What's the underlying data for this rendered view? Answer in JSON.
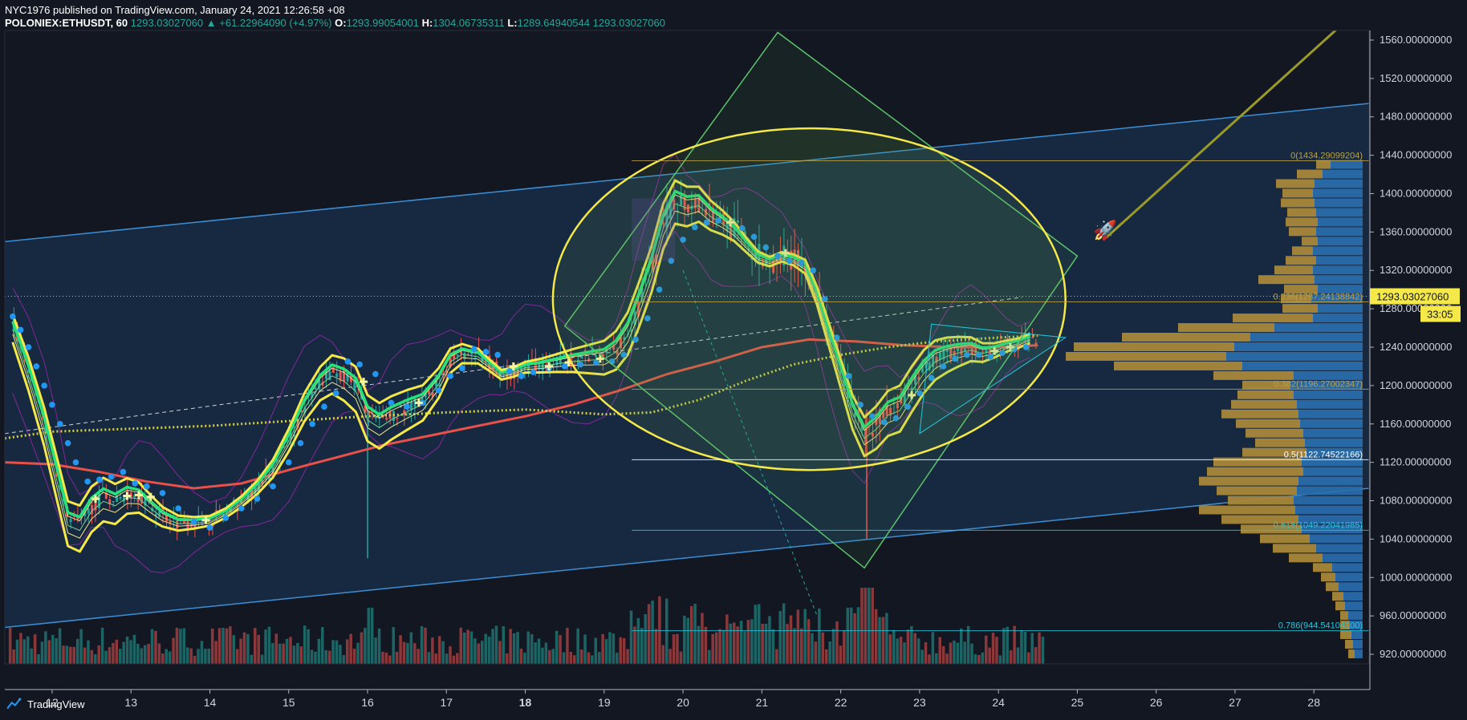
{
  "header": {
    "publisher_line": "NYC1976 published on TradingView.com, January 24, 2021 12:26:58 +08",
    "symbol": "POLONIEX:ETHUSDT, 60",
    "last": "1293.03027060",
    "change": "+61.22964090 (+4.97%)",
    "o_label": "O:",
    "o_value": "1293.99054001",
    "h_label": "H:",
    "h_value": "1304.06735311",
    "l_label": "L:",
    "l_value": "1289.64940544",
    "c_value": "1293.03027060"
  },
  "footer": {
    "brand": "TradingView"
  },
  "colors": {
    "background": "#131722",
    "axis_text": "#d1d4dc",
    "up_volume": "#26a69a",
    "down_volume": "#ef5350",
    "ema_yellow": "#f5e94a",
    "ema_green": "#27e27a",
    "sar_blue": "#2196f3",
    "ma_red": "#e8514a",
    "channel": "#3b8fd6",
    "fib_gold": "#b8a04a",
    "profile_blue": "#2a6fb0",
    "profile_gold": "#a8873a",
    "price_tag": "#f5e94a"
  },
  "chart_data": {
    "type": "candlestick",
    "y_ticks": [
      "1560.00000000",
      "1520.00000000",
      "1480.00000000",
      "1440.00000000",
      "1400.00000000",
      "1360.00000000",
      "1320.00000000",
      "1280.00000000",
      "1240.00000000",
      "1200.00000000",
      "1160.00000000",
      "1120.00000000",
      "1080.00000000",
      "1040.00000000",
      "1000.00000000",
      "960.00000000",
      "920.00000000"
    ],
    "ylim": [
      910,
      1570
    ],
    "x_ticks": [
      "12",
      "13",
      "14",
      "15",
      "16",
      "17",
      "18",
      "19",
      "20",
      "21",
      "22",
      "23",
      "24",
      "25",
      "26",
      "27",
      "28"
    ],
    "x_bold": [
      "18"
    ],
    "xlim": [
      11.4,
      28.7
    ],
    "last_price_label": "1293.03027060",
    "countdown": "33:05",
    "last_price": 1293.03,
    "fib_levels": [
      {
        "label": "0(1434.29099204)",
        "value": 1434.29
      },
      {
        "label": "0.236(1287.24138842)",
        "value": 1287.24
      },
      {
        "label": "0.382(1196.27002347)",
        "value": 1196.27
      },
      {
        "label": "0.5(1122.74522166)",
        "value": 1122.75
      },
      {
        "label": "0.618(1049.22041985)",
        "value": 1049.22
      },
      {
        "label": "0.786(944.54104100)",
        "value": 944.54
      }
    ],
    "fib_x_start": 19.35,
    "price_path": [
      [
        11.5,
        1262
      ],
      [
        11.7,
        1215
      ],
      [
        11.9,
        1160
      ],
      [
        12.05,
        1110
      ],
      [
        12.2,
        1060
      ],
      [
        12.35,
        1055
      ],
      [
        12.5,
        1075
      ],
      [
        12.65,
        1085
      ],
      [
        12.8,
        1080
      ],
      [
        12.95,
        1088
      ],
      [
        13.1,
        1086
      ],
      [
        13.25,
        1075
      ],
      [
        13.4,
        1065
      ],
      [
        13.6,
        1058
      ],
      [
        13.8,
        1058
      ],
      [
        14.0,
        1060
      ],
      [
        14.2,
        1068
      ],
      [
        14.4,
        1080
      ],
      [
        14.6,
        1095
      ],
      [
        14.8,
        1115
      ],
      [
        15.0,
        1145
      ],
      [
        15.2,
        1180
      ],
      [
        15.4,
        1205
      ],
      [
        15.55,
        1215
      ],
      [
        15.7,
        1210
      ],
      [
        15.85,
        1200
      ],
      [
        16.0,
        1170
      ],
      [
        16.15,
        1162
      ],
      [
        16.3,
        1170
      ],
      [
        16.5,
        1178
      ],
      [
        16.7,
        1185
      ],
      [
        16.9,
        1205
      ],
      [
        17.05,
        1228
      ],
      [
        17.2,
        1235
      ],
      [
        17.4,
        1232
      ],
      [
        17.55,
        1222
      ],
      [
        17.7,
        1212
      ],
      [
        17.85,
        1215
      ],
      [
        18.0,
        1220
      ],
      [
        18.2,
        1222
      ],
      [
        18.4,
        1225
      ],
      [
        18.6,
        1228
      ],
      [
        18.8,
        1230
      ],
      [
        19.0,
        1232
      ],
      [
        19.15,
        1240
      ],
      [
        19.3,
        1258
      ],
      [
        19.45,
        1290
      ],
      [
        19.6,
        1325
      ],
      [
        19.75,
        1370
      ],
      [
        19.9,
        1395
      ],
      [
        20.05,
        1390
      ],
      [
        20.2,
        1392
      ],
      [
        20.35,
        1380
      ],
      [
        20.5,
        1372
      ],
      [
        20.65,
        1362
      ],
      [
        20.8,
        1348
      ],
      [
        20.95,
        1335
      ],
      [
        21.1,
        1330
      ],
      [
        21.25,
        1335
      ],
      [
        21.4,
        1332
      ],
      [
        21.55,
        1325
      ],
      [
        21.7,
        1295
      ],
      [
        21.85,
        1255
      ],
      [
        22.0,
        1215
      ],
      [
        22.15,
        1175
      ],
      [
        22.3,
        1150
      ],
      [
        22.45,
        1160
      ],
      [
        22.6,
        1175
      ],
      [
        22.75,
        1180
      ],
      [
        22.9,
        1200
      ],
      [
        23.05,
        1218
      ],
      [
        23.2,
        1230
      ],
      [
        23.35,
        1235
      ],
      [
        23.5,
        1238
      ],
      [
        23.65,
        1240
      ],
      [
        23.8,
        1236
      ],
      [
        23.95,
        1238
      ],
      [
        24.1,
        1242
      ],
      [
        24.25,
        1245
      ],
      [
        24.4,
        1250
      ]
    ],
    "ma_red": [
      [
        11.4,
        1120
      ],
      [
        12,
        1118
      ],
      [
        12.6,
        1110
      ],
      [
        13.2,
        1100
      ],
      [
        13.8,
        1093
      ],
      [
        14.4,
        1098
      ],
      [
        15,
        1112
      ],
      [
        15.6,
        1125
      ],
      [
        16.2,
        1138
      ],
      [
        16.8,
        1148
      ],
      [
        17.4,
        1158
      ],
      [
        18,
        1168
      ],
      [
        18.6,
        1180
      ],
      [
        19.2,
        1195
      ],
      [
        19.8,
        1212
      ],
      [
        20.4,
        1225
      ],
      [
        21,
        1240
      ],
      [
        21.6,
        1248
      ],
      [
        22.2,
        1246
      ],
      [
        22.8,
        1242
      ],
      [
        23.4,
        1240
      ],
      [
        24,
        1240
      ],
      [
        24.5,
        1242
      ]
    ],
    "ma_dotted": [
      [
        11.4,
        1145
      ],
      [
        12,
        1152
      ],
      [
        13,
        1155
      ],
      [
        14,
        1158
      ],
      [
        15,
        1163
      ],
      [
        16,
        1168
      ],
      [
        17,
        1172
      ],
      [
        18,
        1175
      ],
      [
        19,
        1170
      ],
      [
        19.6,
        1172
      ],
      [
        20.2,
        1185
      ],
      [
        20.8,
        1205
      ],
      [
        21.4,
        1222
      ],
      [
        22,
        1232
      ],
      [
        22.6,
        1240
      ],
      [
        23.2,
        1246
      ],
      [
        24,
        1250
      ],
      [
        24.5,
        1252
      ]
    ],
    "sar_points": [
      [
        11.5,
        1272
      ],
      [
        11.6,
        1258
      ],
      [
        11.7,
        1240
      ],
      [
        11.8,
        1220
      ],
      [
        11.9,
        1200
      ],
      [
        12.0,
        1180
      ],
      [
        12.1,
        1160
      ],
      [
        12.2,
        1140
      ],
      [
        12.3,
        1120
      ],
      [
        12.45,
        1100
      ],
      [
        12.6,
        1102
      ],
      [
        12.75,
        1105
      ],
      [
        12.9,
        1110
      ],
      [
        13.05,
        1098
      ],
      [
        13.2,
        1095
      ],
      [
        13.4,
        1088
      ],
      [
        13.6,
        1072
      ],
      [
        13.8,
        1058
      ],
      [
        14.0,
        1052
      ],
      [
        14.2,
        1062
      ],
      [
        14.4,
        1072
      ],
      [
        14.6,
        1082
      ],
      [
        14.8,
        1095
      ],
      [
        15.0,
        1120
      ],
      [
        15.15,
        1140
      ],
      [
        15.3,
        1160
      ],
      [
        15.45,
        1178
      ],
      [
        15.6,
        1192
      ],
      [
        15.75,
        1225
      ],
      [
        15.9,
        1222
      ],
      [
        16.1,
        1212
      ],
      [
        16.3,
        1182
      ],
      [
        16.5,
        1178
      ],
      [
        16.7,
        1182
      ],
      [
        16.9,
        1195
      ],
      [
        17.05,
        1210
      ],
      [
        17.2,
        1218
      ],
      [
        17.35,
        1238
      ],
      [
        17.5,
        1235
      ],
      [
        17.65,
        1232
      ],
      [
        17.8,
        1215
      ],
      [
        17.95,
        1210
      ],
      [
        18.1,
        1214
      ],
      [
        18.3,
        1218
      ],
      [
        18.5,
        1220
      ],
      [
        18.7,
        1222
      ],
      [
        18.9,
        1224
      ],
      [
        19.1,
        1225
      ],
      [
        19.25,
        1232
      ],
      [
        19.4,
        1248
      ],
      [
        19.55,
        1270
      ],
      [
        19.7,
        1300
      ],
      [
        19.85,
        1330
      ],
      [
        20.0,
        1352
      ],
      [
        20.15,
        1365
      ],
      [
        20.3,
        1370
      ],
      [
        20.45,
        1372
      ],
      [
        20.6,
        1370
      ],
      [
        20.75,
        1364
      ],
      [
        20.9,
        1355
      ],
      [
        21.05,
        1344
      ],
      [
        21.2,
        1335
      ],
      [
        21.35,
        1330
      ],
      [
        21.5,
        1328
      ],
      [
        21.65,
        1320
      ],
      [
        21.8,
        1290
      ],
      [
        21.95,
        1250
      ],
      [
        22.1,
        1210
      ],
      [
        22.25,
        1180
      ],
      [
        22.4,
        1168
      ],
      [
        22.55,
        1162
      ],
      [
        22.7,
        1166
      ],
      [
        22.85,
        1178
      ],
      [
        23.0,
        1192
      ],
      [
        23.15,
        1208
      ],
      [
        23.3,
        1220
      ],
      [
        23.45,
        1228
      ],
      [
        23.6,
        1232
      ],
      [
        23.75,
        1232
      ],
      [
        23.9,
        1230
      ],
      [
        24.05,
        1234
      ],
      [
        24.2,
        1238
      ],
      [
        24.35,
        1240
      ]
    ],
    "cross_markers": [
      [
        12.55,
        1082
      ],
      [
        12.95,
        1085
      ],
      [
        13.1,
        1086
      ],
      [
        13.25,
        1084
      ],
      [
        13.95,
        1060
      ],
      [
        15.95,
        1204
      ],
      [
        16.65,
        1182
      ],
      [
        17.85,
        1220
      ],
      [
        18.3,
        1220
      ],
      [
        18.55,
        1224
      ],
      [
        18.95,
        1228
      ],
      [
        20.6,
        1370
      ],
      [
        21.3,
        1338
      ],
      [
        22.9,
        1190
      ],
      [
        23.95,
        1236
      ],
      [
        24.15,
        1240
      ]
    ],
    "volume_profile": [
      {
        "p": 1430,
        "blue": 40,
        "gold": 18
      },
      {
        "p": 1420,
        "blue": 50,
        "gold": 32
      },
      {
        "p": 1410,
        "blue": 60,
        "gold": 48
      },
      {
        "p": 1400,
        "blue": 62,
        "gold": 38
      },
      {
        "p": 1390,
        "blue": 60,
        "gold": 42
      },
      {
        "p": 1380,
        "blue": 58,
        "gold": 36
      },
      {
        "p": 1370,
        "blue": 56,
        "gold": 40
      },
      {
        "p": 1360,
        "blue": 58,
        "gold": 34
      },
      {
        "p": 1350,
        "blue": 56,
        "gold": 20
      },
      {
        "p": 1340,
        "blue": 62,
        "gold": 26
      },
      {
        "p": 1330,
        "blue": 58,
        "gold": 38
      },
      {
        "p": 1320,
        "blue": 62,
        "gold": 48
      },
      {
        "p": 1310,
        "blue": 60,
        "gold": 70
      },
      {
        "p": 1300,
        "blue": 56,
        "gold": 42
      },
      {
        "p": 1290,
        "blue": 64,
        "gold": 38
      },
      {
        "p": 1280,
        "blue": 56,
        "gold": 44
      },
      {
        "p": 1270,
        "blue": 62,
        "gold": 100
      },
      {
        "p": 1260,
        "blue": 110,
        "gold": 120
      },
      {
        "p": 1250,
        "blue": 140,
        "gold": 160
      },
      {
        "p": 1240,
        "blue": 160,
        "gold": 200
      },
      {
        "p": 1230,
        "blue": 170,
        "gold": 200
      },
      {
        "p": 1220,
        "blue": 150,
        "gold": 160
      },
      {
        "p": 1210,
        "blue": 86,
        "gold": 100
      },
      {
        "p": 1200,
        "blue": 90,
        "gold": 60
      },
      {
        "p": 1190,
        "blue": 86,
        "gold": 70
      },
      {
        "p": 1180,
        "blue": 82,
        "gold": 82
      },
      {
        "p": 1170,
        "blue": 80,
        "gold": 96
      },
      {
        "p": 1160,
        "blue": 78,
        "gold": 80
      },
      {
        "p": 1150,
        "blue": 74,
        "gold": 72
      },
      {
        "p": 1140,
        "blue": 72,
        "gold": 62
      },
      {
        "p": 1130,
        "blue": 70,
        "gold": 80
      },
      {
        "p": 1120,
        "blue": 76,
        "gold": 110
      },
      {
        "p": 1110,
        "blue": 74,
        "gold": 120
      },
      {
        "p": 1100,
        "blue": 80,
        "gold": 124
      },
      {
        "p": 1090,
        "blue": 82,
        "gold": 100
      },
      {
        "p": 1080,
        "blue": 86,
        "gold": 82
      },
      {
        "p": 1070,
        "blue": 84,
        "gold": 120
      },
      {
        "p": 1060,
        "blue": 80,
        "gold": 96
      },
      {
        "p": 1050,
        "blue": 76,
        "gold": 76
      },
      {
        "p": 1040,
        "blue": 66,
        "gold": 62
      },
      {
        "p": 1030,
        "blue": 58,
        "gold": 54
      },
      {
        "p": 1020,
        "blue": 50,
        "gold": 42
      },
      {
        "p": 1010,
        "blue": 38,
        "gold": 24
      },
      {
        "p": 1000,
        "blue": 34,
        "gold": 18
      },
      {
        "p": 990,
        "blue": 30,
        "gold": 16
      },
      {
        "p": 980,
        "blue": 24,
        "gold": 14
      },
      {
        "p": 970,
        "blue": 22,
        "gold": 12
      },
      {
        "p": 960,
        "blue": 18,
        "gold": 10
      },
      {
        "p": 950,
        "blue": 16,
        "gold": 12
      },
      {
        "p": 940,
        "blue": 14,
        "gold": 14
      },
      {
        "p": 930,
        "blue": 12,
        "gold": 10
      },
      {
        "p": 920,
        "blue": 10,
        "gold": 8
      }
    ]
  }
}
